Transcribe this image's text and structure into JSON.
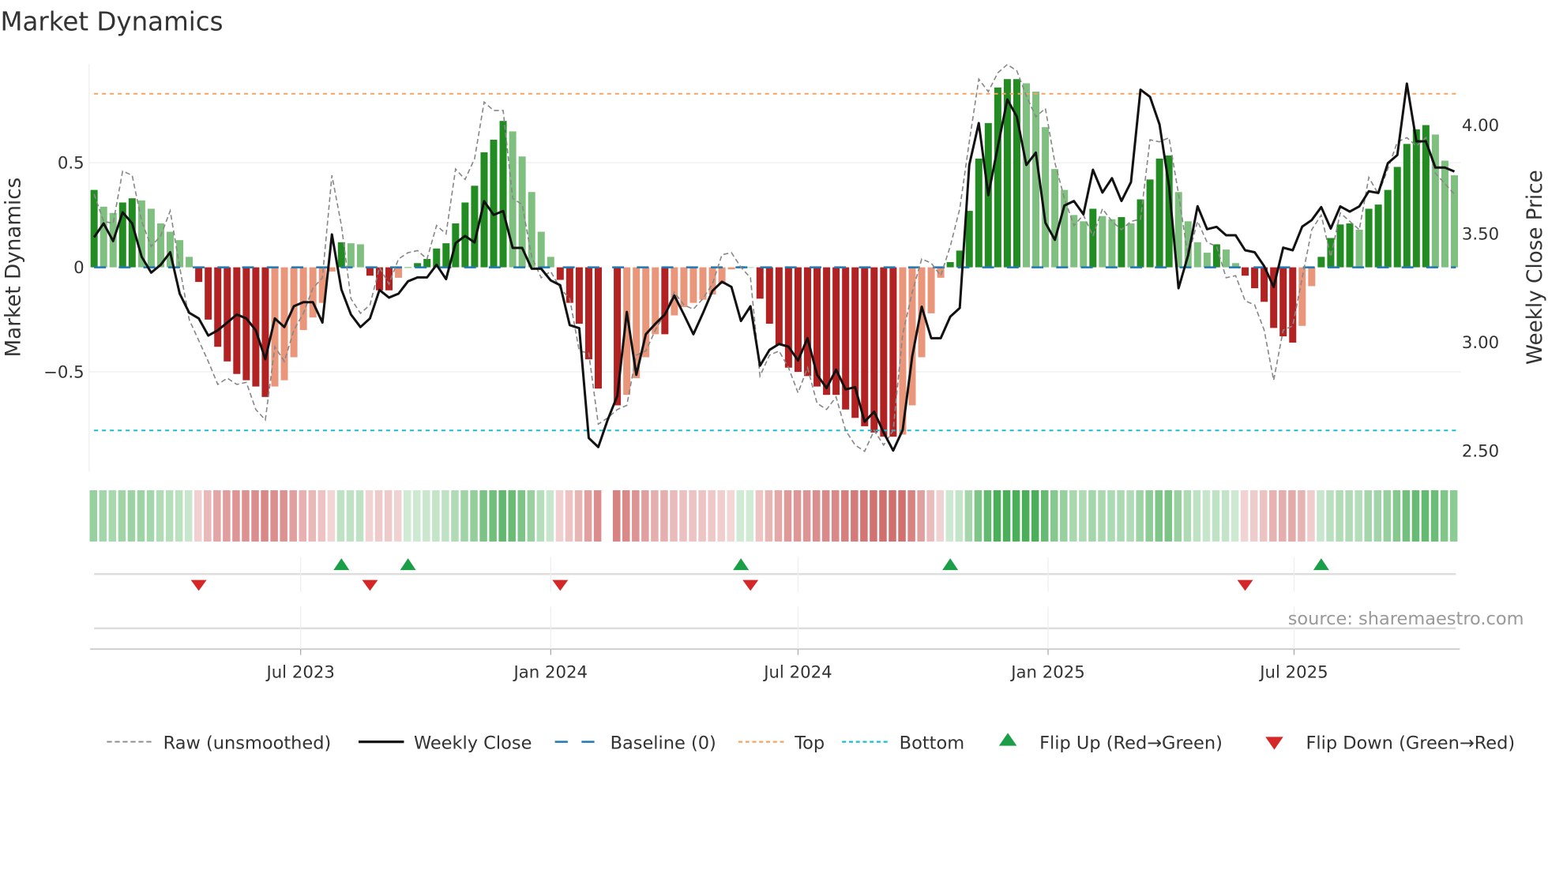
{
  "title": "Market Dynamics",
  "source": "source: sharemaestro.com",
  "colors": {
    "bar_up_strong": "#228B22",
    "bar_up_weak": "#7FBF7F",
    "bar_down_strong": "#B22222",
    "bar_down_weak": "#E9967A",
    "price": "#111111",
    "raw": "#888888",
    "baseline": "#1F77B4",
    "top": "#F4A460",
    "bottom": "#17BECF",
    "flip_up": "#1A9E48",
    "flip_down": "#D62728"
  },
  "legend": [
    {
      "key": "raw",
      "label": "Raw (unsmoothed)"
    },
    {
      "key": "price",
      "label": "Weekly Close"
    },
    {
      "key": "baseline",
      "label": "Baseline (0)"
    },
    {
      "key": "top",
      "label": "Top"
    },
    {
      "key": "bottom",
      "label": "Bottom"
    },
    {
      "key": "flip_up",
      "label": "Flip Up (Red→Green)"
    },
    {
      "key": "flip_down",
      "label": "Flip Down (Green→Red)"
    }
  ],
  "chart_data": {
    "type": "bar",
    "title": "Market Dynamics",
    "ylabel": "Market Dynamics",
    "y2label": "Weekly Close Price",
    "start_date": "2023-01-30",
    "interval": "weekly",
    "ylim": [
      -0.95,
      0.98
    ],
    "y2lim": [
      2.43,
      4.3
    ],
    "yticks": [
      {
        "v": 0.5,
        "label": "0.5"
      },
      {
        "v": 0,
        "label": "0"
      },
      {
        "v": -0.5,
        "label": "−0.5"
      }
    ],
    "y2ticks": [
      {
        "v": 4.0,
        "label": "4.00"
      },
      {
        "v": 3.5,
        "label": "3.50"
      },
      {
        "v": 3.0,
        "label": "3.00"
      },
      {
        "v": 2.5,
        "label": "2.50"
      }
    ],
    "xticks": [
      {
        "date": "2023-07-01",
        "label": "Jul 2023"
      },
      {
        "date": "2024-01-01",
        "label": "Jan 2024"
      },
      {
        "date": "2024-07-01",
        "label": "Jul 2024"
      },
      {
        "date": "2025-01-01",
        "label": "Jan 2025"
      },
      {
        "date": "2025-07-01",
        "label": "Jul 2025"
      }
    ],
    "top_level": 0.83,
    "bottom_level": -0.78,
    "baseline": 0,
    "dynamics": [
      0.37,
      0.29,
      0.26,
      0.31,
      0.33,
      0.32,
      0.28,
      0.21,
      0.17,
      0.13,
      0.05,
      -0.07,
      -0.25,
      -0.38,
      -0.45,
      -0.51,
      -0.54,
      -0.57,
      -0.62,
      -0.57,
      -0.54,
      -0.43,
      -0.3,
      -0.24,
      -0.17,
      -0.02,
      0.12,
      0.115,
      0.11,
      -0.04,
      -0.11,
      -0.11,
      -0.05,
      0.0,
      0.02,
      0.04,
      0.09,
      0.115,
      0.21,
      0.31,
      0.39,
      0.55,
      0.61,
      0.7,
      0.65,
      0.53,
      0.36,
      0.17,
      0.05,
      -0.06,
      -0.17,
      -0.27,
      -0.44,
      -0.58,
      null,
      -0.66,
      -0.61,
      -0.53,
      -0.43,
      -0.32,
      -0.32,
      -0.23,
      -0.19,
      -0.17,
      -0.155,
      -0.13,
      -0.08,
      -0.01,
      0.005,
      0.0,
      -0.15,
      -0.27,
      -0.37,
      -0.48,
      -0.5,
      -0.52,
      -0.57,
      -0.61,
      -0.61,
      -0.68,
      -0.72,
      -0.76,
      -0.79,
      -0.81,
      -0.81,
      -0.8,
      -0.66,
      -0.43,
      -0.22,
      -0.05,
      0.025,
      0.08,
      0.27,
      0.52,
      0.69,
      0.86,
      0.9,
      0.9,
      0.88,
      0.84,
      0.67,
      0.47,
      0.37,
      0.25,
      0.22,
      0.28,
      0.245,
      0.23,
      0.24,
      0.21,
      0.325,
      0.42,
      0.52,
      0.535,
      0.36,
      0.22,
      0.12,
      0.07,
      0.11,
      0.085,
      0.02,
      -0.04,
      -0.1,
      -0.165,
      -0.29,
      -0.33,
      -0.36,
      -0.28,
      -0.09,
      0.05,
      0.14,
      0.205,
      0.21,
      0.18,
      0.28,
      0.3,
      0.37,
      0.48,
      0.59,
      0.66,
      0.68,
      0.635,
      0.51,
      0.44
    ],
    "raw": [
      0.35,
      0.22,
      0.21,
      0.46,
      0.44,
      0.22,
      0.1,
      0.15,
      0.27,
      0.0,
      -0.25,
      -0.35,
      -0.45,
      -0.56,
      -0.53,
      -0.56,
      -0.55,
      -0.68,
      -0.73,
      -0.38,
      -0.45,
      -0.3,
      -0.22,
      -0.1,
      -0.05,
      0.44,
      0.2,
      -0.15,
      -0.22,
      -0.18,
      0.0,
      -0.08,
      0.04,
      0.07,
      0.08,
      0.04,
      0.2,
      0.16,
      0.47,
      0.42,
      0.52,
      0.79,
      0.75,
      0.75,
      0.33,
      0.3,
      0.05,
      -0.05,
      -0.02,
      -0.1,
      -0.15,
      -0.4,
      -0.41,
      -0.75,
      -0.72,
      -0.68,
      -0.66,
      -0.42,
      -0.4,
      -0.3,
      -0.22,
      -0.12,
      -0.18,
      -0.2,
      -0.15,
      -0.08,
      0.06,
      0.07,
      0.0,
      -0.05,
      -0.52,
      -0.42,
      -0.4,
      -0.48,
      -0.6,
      -0.48,
      -0.65,
      -0.68,
      -0.62,
      -0.78,
      -0.85,
      -0.88,
      -0.78,
      -0.85,
      -0.78,
      -0.32,
      -0.12,
      0.04,
      0.02,
      -0.04,
      0.1,
      0.28,
      0.6,
      0.9,
      0.84,
      0.93,
      0.97,
      0.94,
      0.82,
      0.72,
      0.76,
      0.5,
      0.33,
      0.2,
      0.25,
      0.15,
      0.28,
      0.22,
      0.18,
      0.22,
      0.23,
      0.61,
      0.6,
      0.62,
      0.35,
      0.05,
      0.22,
      0.12,
      0.1,
      -0.05,
      -0.04,
      -0.16,
      -0.18,
      -0.3,
      -0.54,
      -0.3,
      -0.28,
      -0.05,
      0.18,
      0.25,
      0.05,
      0.26,
      0.22,
      0.18,
      0.43,
      0.35,
      0.47,
      0.6,
      0.62,
      0.58,
      0.62,
      0.45,
      0.4,
      0.35
    ],
    "weekly_close": [
      3.484,
      3.548,
      3.466,
      3.599,
      3.548,
      3.394,
      3.321,
      3.357,
      3.415,
      3.224,
      3.136,
      3.11,
      3.031,
      3.055,
      3.091,
      3.128,
      3.11,
      3.055,
      2.922,
      3.11,
      3.07,
      3.166,
      3.185,
      3.185,
      3.091,
      3.497,
      3.243,
      3.128,
      3.07,
      3.11,
      3.241,
      3.206,
      3.224,
      3.281,
      3.299,
      3.299,
      3.357,
      3.291,
      3.457,
      3.49,
      3.46,
      3.65,
      3.587,
      3.605,
      3.435,
      3.435,
      3.339,
      3.339,
      3.285,
      3.263,
      3.079,
      3.065,
      2.559,
      2.517,
      2.644,
      2.753,
      3.14,
      2.85,
      3.037,
      3.085,
      3.128,
      3.215,
      3.128,
      3.037,
      3.134,
      3.237,
      3.279,
      3.255,
      3.098,
      3.166,
      2.892,
      2.965,
      2.992,
      2.98,
      2.916,
      3.019,
      2.85,
      2.789,
      2.874,
      2.783,
      2.793,
      2.634,
      2.68,
      2.584,
      2.501,
      2.596,
      2.934,
      3.164,
      3.019,
      3.019,
      3.118,
      3.158,
      3.817,
      4.01,
      3.678,
      3.901,
      4.119,
      4.04,
      3.817,
      3.874,
      3.551,
      3.472,
      3.63,
      3.651,
      3.59,
      3.795,
      3.69,
      3.756,
      3.651,
      3.738,
      4.164,
      4.131,
      4.004,
      3.72,
      3.249,
      3.4,
      3.627,
      3.521,
      3.532,
      3.493,
      3.493,
      3.424,
      3.415,
      3.351,
      3.255,
      3.436,
      3.424,
      3.533,
      3.563,
      3.623,
      3.524,
      3.626,
      3.602,
      3.626,
      3.696,
      3.688,
      3.825,
      3.863,
      4.192,
      3.926,
      3.926,
      3.805,
      3.805,
      3.787
    ],
    "flip_up_weeks": [
      26,
      33,
      68,
      90,
      129
    ],
    "flip_down_weeks": [
      11,
      29,
      49,
      69,
      121
    ]
  }
}
